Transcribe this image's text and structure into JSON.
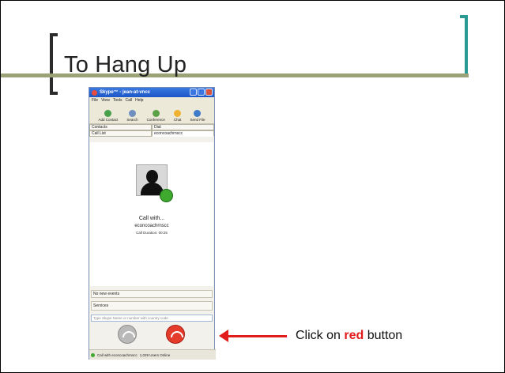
{
  "slide": {
    "title": "To Hang Up",
    "caption_before": "Click on ",
    "caption_red": "red",
    "caption_after": " button"
  },
  "skype": {
    "window_title": "Skype™ - jean-at-vncc",
    "menu": [
      "File",
      "View",
      "Tools",
      "Call",
      "Help"
    ],
    "toolbar": [
      "Add Contact",
      "Search",
      "Conference",
      "Chat",
      "Send File"
    ],
    "tabs_top": [
      "Contacts",
      "Dial"
    ],
    "tabs_bottom": [
      "Call List",
      "econcoachrnscc"
    ],
    "call_with": "Call with...",
    "contact_name": "econcoachrnscc",
    "call_duration": "Call Duration: 00:25",
    "no_new_events": "No new events",
    "services": "Services",
    "dial_placeholder": "Type Skype Name or number with country code",
    "status_call": "Call with econcoachrnscc",
    "users_online": "1,029 Users Online"
  },
  "colors": {
    "accent_teal": "#2a9a95",
    "title_bar_olive": "#9aa277",
    "arrow_red": "#e21b1b",
    "hangup_red": "#e53b2a"
  }
}
